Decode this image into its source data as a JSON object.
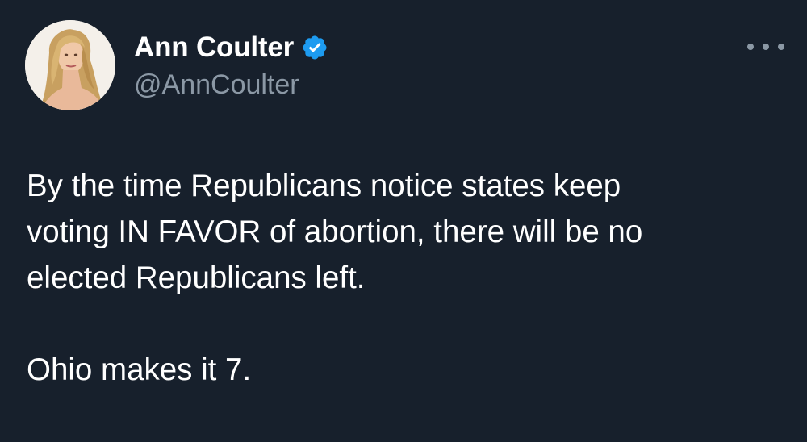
{
  "author": {
    "display_name": "Ann Coulter",
    "handle": "@AnnCoulter",
    "verified": true,
    "verified_color": "#1d9bf0",
    "avatar_icon": "profile-photo"
  },
  "more_menu": {
    "icon": "more-horizontal-icon"
  },
  "tweet": {
    "lines": [
      "By the time Republicans notice states keep",
      "voting IN FAVOR of abortion, there will be no",
      "elected Republicans left."
    ],
    "closing": "Ohio makes it 7."
  },
  "colors": {
    "background": "#17202c",
    "text": "#ffffff",
    "secondary_text": "#8b98a5"
  }
}
